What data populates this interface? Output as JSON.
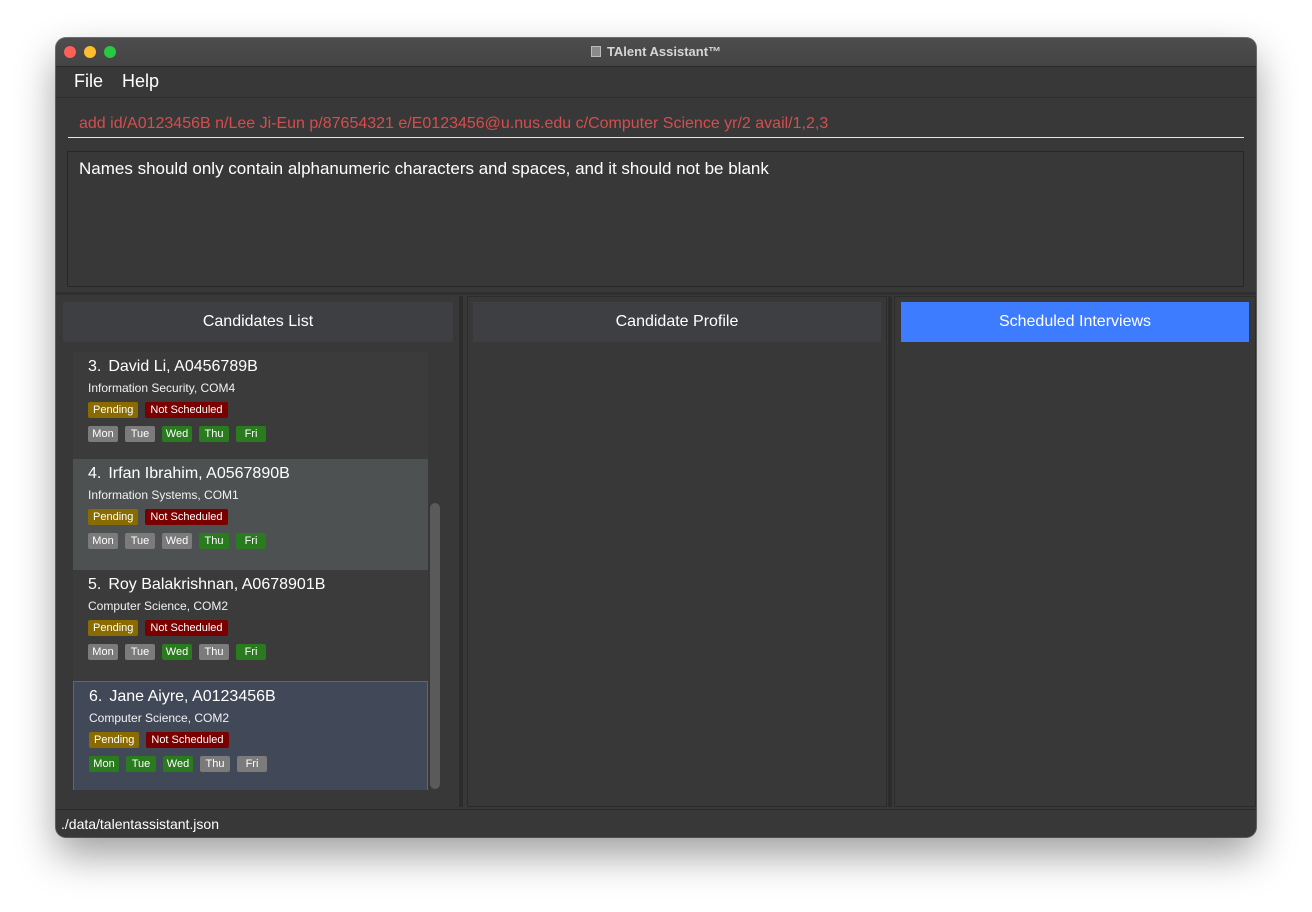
{
  "window": {
    "title": "TAlent Assistant™"
  },
  "menu": {
    "file": "File",
    "help": "Help"
  },
  "command": {
    "value": "add id/A0123456B n/Lee Ji-Eun p/87654321 e/E0123456@u.nus.edu c/Computer Science yr/2 avail/1,2,3"
  },
  "result": {
    "text": "Names should only contain alphanumeric characters and spaces, and it should not be blank"
  },
  "panels": {
    "candidates_list": "Candidates List",
    "candidate_profile": "Candidate Profile",
    "scheduled_interviews": "Scheduled Interviews"
  },
  "colors": {
    "accent": "#3d7bff",
    "pending": "#8a6b00",
    "not_scheduled": "#7a0000",
    "available": "#2a7a1f",
    "unavailable": "#7b7b7b",
    "command_text": "#d64d4d"
  },
  "candidates": [
    {
      "index": "3.",
      "name": "David Li, A0456789B",
      "details": "Information Security, COM4",
      "status": "Pending",
      "interview": "Not Scheduled",
      "days": [
        {
          "label": "Mon",
          "available": false
        },
        {
          "label": "Tue",
          "available": false
        },
        {
          "label": "Wed",
          "available": true
        },
        {
          "label": "Thu",
          "available": true
        },
        {
          "label": "Fri",
          "available": true
        }
      ]
    },
    {
      "index": "4.",
      "name": "Irfan Ibrahim, A0567890B",
      "details": "Information Systems, COM1",
      "status": "Pending",
      "interview": "Not Scheduled",
      "days": [
        {
          "label": "Mon",
          "available": false
        },
        {
          "label": "Tue",
          "available": false
        },
        {
          "label": "Wed",
          "available": false
        },
        {
          "label": "Thu",
          "available": true
        },
        {
          "label": "Fri",
          "available": true
        }
      ]
    },
    {
      "index": "5.",
      "name": "Roy Balakrishnan, A0678901B",
      "details": "Computer Science, COM2",
      "status": "Pending",
      "interview": "Not Scheduled",
      "days": [
        {
          "label": "Mon",
          "available": false
        },
        {
          "label": "Tue",
          "available": false
        },
        {
          "label": "Wed",
          "available": true
        },
        {
          "label": "Thu",
          "available": false
        },
        {
          "label": "Fri",
          "available": true
        }
      ]
    },
    {
      "index": "6.",
      "name": "Jane Aiyre, A0123456B",
      "details": "Computer Science, COM2",
      "status": "Pending",
      "interview": "Not Scheduled",
      "days": [
        {
          "label": "Mon",
          "available": true
        },
        {
          "label": "Tue",
          "available": true
        },
        {
          "label": "Wed",
          "available": true
        },
        {
          "label": "Thu",
          "available": false
        },
        {
          "label": "Fri",
          "available": false
        }
      ]
    }
  ],
  "status_bar": {
    "path": "./data/talentassistant.json"
  }
}
